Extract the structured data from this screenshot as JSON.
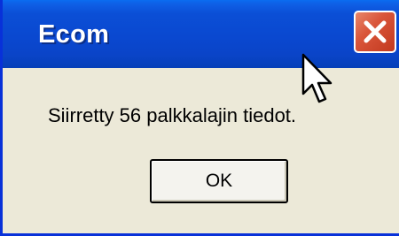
{
  "window": {
    "title": "Ecom",
    "close_icon": "close-icon"
  },
  "dialog": {
    "message": "Siirretty 56 palkkalajin tiedot.",
    "ok_label": "OK"
  },
  "colors": {
    "titlebar": "#0a48d0",
    "close_button": "#d9553a",
    "dialog_background": "#ece9d8"
  }
}
